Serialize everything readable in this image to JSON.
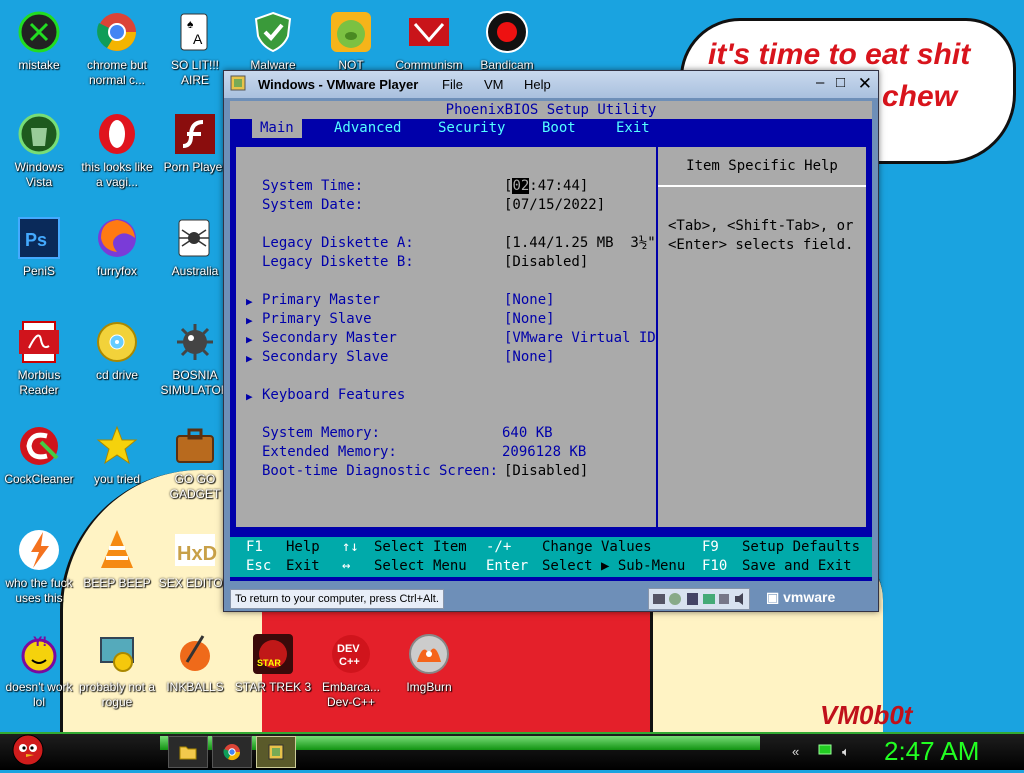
{
  "wallpaper": {
    "speech_bubble_line1": "it's time to eat shit",
    "speech_bubble_line2": "chew",
    "signature": "VM0b0t"
  },
  "desktop_icons": [
    {
      "label": "mistake",
      "icon": "xbox-icon"
    },
    {
      "label": "chrome but normal c...",
      "icon": "chrome-icon"
    },
    {
      "label": "SO LIT!!! AIRE",
      "icon": "solitaire-icon"
    },
    {
      "label": "Malware",
      "icon": "shield-icon"
    },
    {
      "label": "NOT",
      "icon": "bad-piggies-icon"
    },
    {
      "label": "Communism",
      "icon": "communism-icon"
    },
    {
      "label": "Bandicam",
      "icon": "bandicam-icon"
    },
    {
      "label": "Windows Vista",
      "icon": "recycle-bin-icon"
    },
    {
      "label": "this looks like a vagi...",
      "icon": "opera-icon"
    },
    {
      "label": "Porn Player",
      "icon": "flash-icon"
    },
    {
      "label": "PeniS",
      "icon": "photoshop-icon"
    },
    {
      "label": "furryfox",
      "icon": "firefox-icon"
    },
    {
      "label": "Australia",
      "icon": "spider-solitaire-icon"
    },
    {
      "label": "Morbius Reader",
      "icon": "acrobat-icon"
    },
    {
      "label": "cd drive",
      "icon": "cd-icon"
    },
    {
      "label": "BOSNIA SIMULATOR",
      "icon": "minesweeper-icon"
    },
    {
      "label": "CockCleaner",
      "icon": "ccleaner-icon"
    },
    {
      "label": "you tried",
      "icon": "star-icon"
    },
    {
      "label": "GO GO GADGET",
      "icon": "briefcase-icon"
    },
    {
      "label": "who the fuck uses this",
      "icon": "avast-icon"
    },
    {
      "label": "BEEP BEEP",
      "icon": "vlc-icon"
    },
    {
      "label": "SEX EDITOR",
      "icon": "hxd-icon"
    },
    {
      "label": "doesn't work lol",
      "icon": "yahoo-messenger-icon"
    },
    {
      "label": "probably not a rogue",
      "icon": "control-panel-icon"
    },
    {
      "label": "INKBALLS",
      "icon": "inkball-icon"
    },
    {
      "label": "STAR TREK 3",
      "icon": "star-wars-icon"
    },
    {
      "label": "Embarca... Dev-C++",
      "icon": "devcpp-icon"
    },
    {
      "label": "ImgBurn",
      "icon": "imgburn-icon"
    }
  ],
  "vm_window": {
    "title": "Windows - VMware Player",
    "menus": [
      "File",
      "VM",
      "Help"
    ],
    "status_text": "To return to your computer, press Ctrl+Alt.",
    "logo": "vmware"
  },
  "bios": {
    "title": "PhoenixBIOS Setup Utility",
    "tabs": [
      "Main",
      "Advanced",
      "Security",
      "Boot",
      "Exit"
    ],
    "active_tab": "Main",
    "fields": {
      "system_time_label": "System Time:",
      "system_time_cursor": "02",
      "system_time_rest": ":47:44]",
      "system_date_label": "System Date:",
      "system_date_value": "[07/15/2022]",
      "legacy_a_label": "Legacy Diskette A:",
      "legacy_a_value": "[1.44/1.25 MB  3½\"]",
      "legacy_b_label": "Legacy Diskette B:",
      "legacy_b_value": "[Disabled]",
      "primary_master_label": "Primary Master",
      "primary_master_value": "[None]",
      "primary_slave_label": "Primary Slave",
      "primary_slave_value": "[None]",
      "secondary_master_label": "Secondary Master",
      "secondary_master_value": "[VMware Virtual ID]",
      "secondary_slave_label": "Secondary Slave",
      "secondary_slave_value": "[None]",
      "keyboard_label": "Keyboard Features",
      "system_memory_label": "System Memory:",
      "system_memory_value": "640 KB",
      "extended_memory_label": "Extended Memory:",
      "extended_memory_value": "2096128 KB",
      "boot_diag_label": "Boot-time Diagnostic Screen:",
      "boot_diag_value": "[Disabled]"
    },
    "help_title": "Item Specific Help",
    "help_line1": "<Tab>, <Shift-Tab>, or",
    "help_line2": "<Enter> selects field.",
    "footer": {
      "f1": "F1",
      "f1_desc": "Help",
      "updown": "↑↓",
      "updown_desc": "Select Item",
      "minusplus": "-/+",
      "minusplus_desc": "Change Values",
      "f9": "F9",
      "f9_desc": "Setup Defaults",
      "esc": "Esc",
      "esc_desc": "Exit",
      "leftright": "↔",
      "leftright_desc": "Select Menu",
      "enter": "Enter",
      "enter_desc": "Select ▶ Sub-Menu",
      "f10": "F10",
      "f10_desc": "Save and Exit"
    }
  },
  "taskbar": {
    "clock": "2:47 AM"
  },
  "colors": {
    "desktop_bg": "#1aa3e0",
    "bios_blue": "#0000aa",
    "bios_gray": "#aaaaaa",
    "bios_cyan": "#00aaaa",
    "clock_green": "#22ff22"
  }
}
